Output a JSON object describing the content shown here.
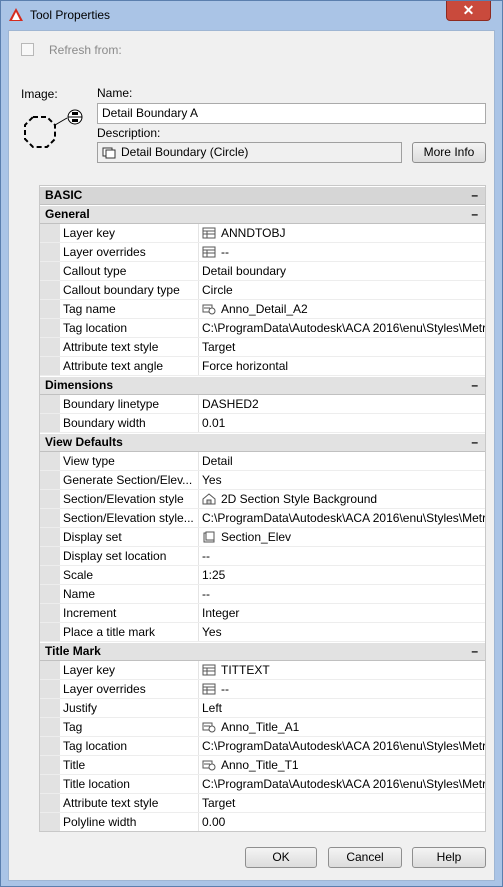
{
  "window": {
    "title": "Tool Properties",
    "close_label": "✕"
  },
  "refresh": {
    "label": "Refresh from:"
  },
  "image_label": "Image:",
  "name": {
    "label": "Name:",
    "value": "Detail Boundary A"
  },
  "description": {
    "label": "Description:",
    "value": "Detail Boundary (Circle)",
    "more_info": "More Info"
  },
  "sections": {
    "basic": {
      "label": "BASIC",
      "toggle": "–"
    },
    "general": {
      "label": "General",
      "toggle": "–",
      "rows": [
        {
          "name": "Layer key",
          "value": "ANNDTOBJ",
          "icon": "table-icon"
        },
        {
          "name": "Layer overrides",
          "value": "--",
          "icon": "table-icon"
        },
        {
          "name": "Callout type",
          "value": "Detail boundary",
          "icon": ""
        },
        {
          "name": "Callout boundary type",
          "value": "Circle",
          "icon": ""
        },
        {
          "name": "Tag name",
          "value": "Anno_Detail_A2",
          "icon": "block-icon"
        },
        {
          "name": "Tag location",
          "value": "C:\\ProgramData\\Autodesk\\ACA 2016\\enu\\Styles\\Metric\\...",
          "icon": ""
        },
        {
          "name": "Attribute text style",
          "value": "Target",
          "icon": ""
        },
        {
          "name": "Attribute text angle",
          "value": "Force horizontal",
          "icon": ""
        }
      ]
    },
    "dimensions": {
      "label": "Dimensions",
      "toggle": "–",
      "rows": [
        {
          "name": "Boundary linetype",
          "value": "DASHED2",
          "icon": ""
        },
        {
          "name": "Boundary width",
          "value": "0.01",
          "icon": ""
        }
      ]
    },
    "view_defaults": {
      "label": "View Defaults",
      "toggle": "–",
      "rows": [
        {
          "name": "View type",
          "value": "Detail",
          "icon": ""
        },
        {
          "name": "Generate  Section/Elev...",
          "value": "Yes",
          "icon": ""
        },
        {
          "name": "Section/Elevation style",
          "value": "2D Section Style Background",
          "icon": "house-icon"
        },
        {
          "name": "Section/Elevation  style...",
          "value": "C:\\ProgramData\\Autodesk\\ACA 2016\\enu\\Styles\\Metric\\...",
          "icon": ""
        },
        {
          "name": "Display set",
          "value": "Section_Elev",
          "icon": "display-set-icon"
        },
        {
          "name": "Display set location",
          "value": "--",
          "icon": ""
        },
        {
          "name": "Scale",
          "value": "1:25",
          "icon": ""
        },
        {
          "name": "Name",
          "value": "--",
          "icon": ""
        },
        {
          "name": "Increment",
          "value": "Integer",
          "icon": ""
        },
        {
          "name": "Place a title mark",
          "value": "Yes",
          "icon": ""
        }
      ]
    },
    "title_mark": {
      "label": "Title Mark",
      "toggle": "–",
      "rows": [
        {
          "name": "Layer key",
          "value": "TITTEXT",
          "icon": "table-icon"
        },
        {
          "name": "Layer overrides",
          "value": "--",
          "icon": "table-icon"
        },
        {
          "name": "Justify",
          "value": "Left",
          "icon": ""
        },
        {
          "name": "Tag",
          "value": "Anno_Title_A1",
          "icon": "block-icon"
        },
        {
          "name": "Tag location",
          "value": "C:\\ProgramData\\Autodesk\\ACA 2016\\enu\\Styles\\Metric\\...",
          "icon": ""
        },
        {
          "name": "Title",
          "value": "Anno_Title_T1",
          "icon": "block-icon"
        },
        {
          "name": "Title location",
          "value": "C:\\ProgramData\\Autodesk\\ACA 2016\\enu\\Styles\\Metric\\...",
          "icon": ""
        },
        {
          "name": "Attribute text style",
          "value": "Target",
          "icon": ""
        },
        {
          "name": "Polyline width",
          "value": "0.00",
          "icon": ""
        }
      ]
    }
  },
  "buttons": {
    "ok": "OK",
    "cancel": "Cancel",
    "help": "Help"
  }
}
